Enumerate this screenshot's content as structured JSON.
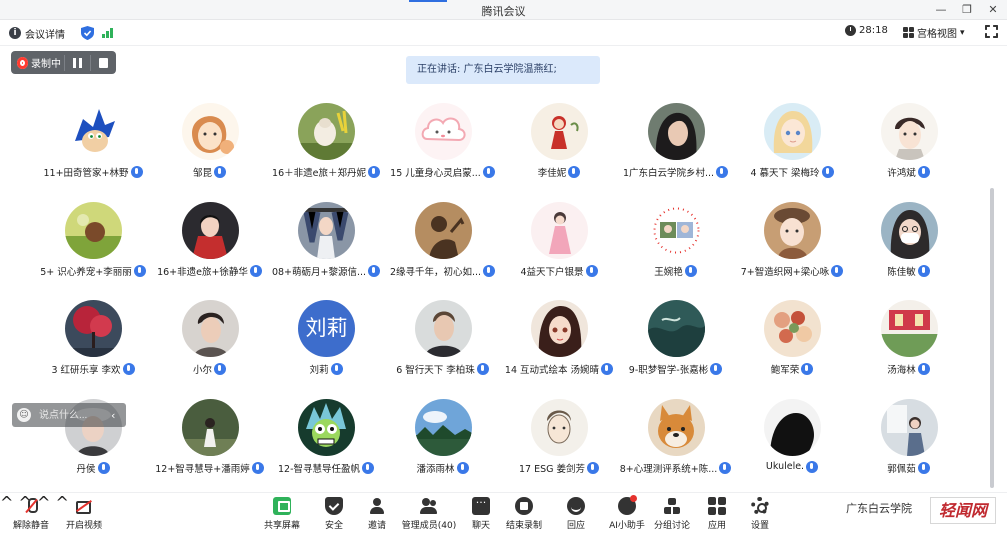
{
  "window": {
    "title": "腾讯会议",
    "minimize": "—",
    "restore": "❐",
    "close": "✕"
  },
  "topbar": {
    "meeting_info_icon": "i",
    "meeting_info": "会议详情",
    "timer": "28:18",
    "view_mode": "宫格视图",
    "view_caret": "▾"
  },
  "recording": {
    "label": "录制中"
  },
  "speaking": {
    "text": "正在讲话: 广东白云学院温燕红;"
  },
  "participants": [
    {
      "name": "11+田奇管家+林野",
      "avatar": "sonic"
    },
    {
      "name": "邹昆",
      "avatar": "girl-sketch"
    },
    {
      "name": "16＋非遗e旅＋郑丹妮",
      "avatar": "lamb"
    },
    {
      "name": "15 儿童身心灵启蒙...",
      "avatar": "cloud"
    },
    {
      "name": "李佳妮",
      "avatar": "red-girl"
    },
    {
      "name": "1广东白云学院乡村...",
      "avatar": "dark-hair"
    },
    {
      "name": "4 慕天下 梁梅玲",
      "avatar": "anime-blonde"
    },
    {
      "name": "许鸿斌",
      "avatar": "boy-sketch"
    },
    {
      "name": "5+ 识心养宠+李丽丽",
      "avatar": "field"
    },
    {
      "name": "16+非遗e旅+徐静华",
      "avatar": "red-jacket"
    },
    {
      "name": "08+萌砺月+黎源信...",
      "avatar": "closet"
    },
    {
      "name": "2缘寻千年，初心如...",
      "avatar": "shadow"
    },
    {
      "name": "4益天下户银景",
      "avatar": "pink-dress"
    },
    {
      "name": "王婉艳",
      "avatar": "collage"
    },
    {
      "name": "7+智造织网+梁心咏",
      "avatar": "beret"
    },
    {
      "name": "陈佳敏",
      "avatar": "mask"
    },
    {
      "name": "3 红研乐享 李欢",
      "avatar": "red-tree"
    },
    {
      "name": "小尔",
      "avatar": "young-man"
    },
    {
      "name": "刘莉",
      "avatar": "text",
      "avatar_text": "刘莉"
    },
    {
      "name": "6 智行天下 李柏珠",
      "avatar": "man-portrait"
    },
    {
      "name": "14 互动式绘本 汤婉晴",
      "avatar": "anime-dark"
    },
    {
      "name": "9-职梦智学-张嘉彬",
      "avatar": "water"
    },
    {
      "name": "鲍军荣",
      "avatar": "flowers"
    },
    {
      "name": "汤海林",
      "avatar": "red-banner"
    },
    {
      "name": "丹侯",
      "avatar": "white-hat"
    },
    {
      "name": "12+智寻慧导+潘雨婷",
      "avatar": "forest-girl"
    },
    {
      "name": "12-智寻慧导任盈帆",
      "avatar": "rick"
    },
    {
      "name": "潘添雨林",
      "avatar": "sky"
    },
    {
      "name": "17 ESG 姜剑芳",
      "avatar": "sketch-man"
    },
    {
      "name": "8+心理测评系统+陈...",
      "avatar": "shiba"
    },
    {
      "name": "Ukulele.",
      "avatar": "silhouette"
    },
    {
      "name": "郭佩茹",
      "avatar": "window-girl"
    }
  ],
  "chat": {
    "placeholder": "说点什么...",
    "emoji_icon": "☺",
    "collapse": "‹"
  },
  "toolbar": {
    "caret": "^",
    "unmute": "解除静音",
    "start_video": "开启视频",
    "share_screen": "共享屏幕",
    "security": "安全",
    "invite": "邀请",
    "manage_members": "管理成员(40)",
    "chat": "聊天",
    "end_recording": "结束录制",
    "reactions": "回应",
    "ai_assistant": "AI小助手",
    "breakout": "分组讨论",
    "apps": "应用",
    "settings": "设置"
  },
  "watermark": {
    "text": "广东白云学院",
    "logo": "轻闻网"
  },
  "colors": {
    "accent": "#2f6fe0",
    "recording_bg": "#5f6368",
    "speaking_bg": "#dbe9fb",
    "share_green": "#2fb25a",
    "mic_blue": "#3a78e8"
  }
}
